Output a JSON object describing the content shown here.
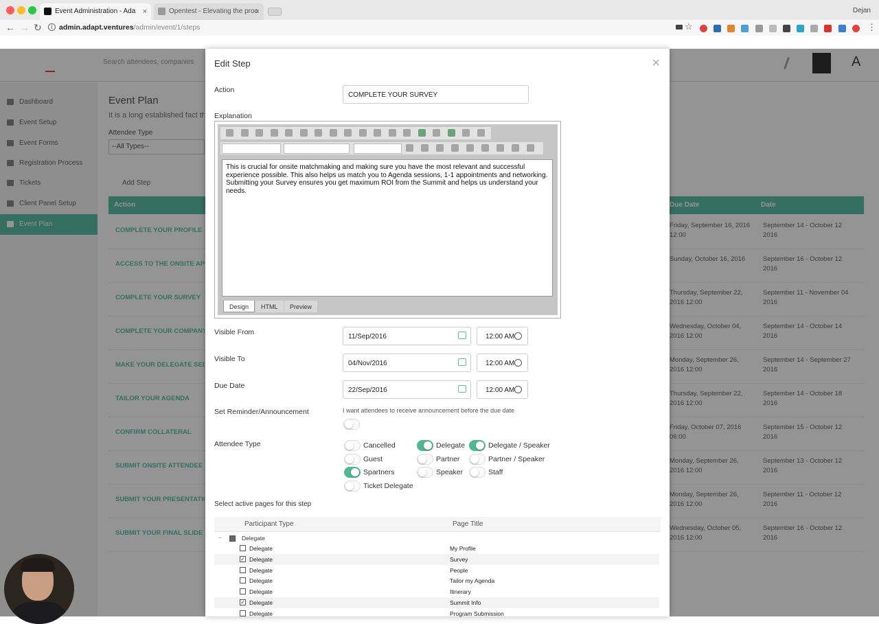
{
  "browser": {
    "tabs": [
      {
        "label": "Event Administration - Ada",
        "active": true
      },
      {
        "label": "Opentest - Elevating the proc",
        "active": false
      }
    ],
    "url_host": "admin.adapt.ventures",
    "url_path": "/admin/event/1/steps",
    "user": "Dejan"
  },
  "app": {
    "search_placeholder": "Search attendees, companies",
    "sidebar": [
      {
        "label": "Dashboard",
        "icon": "chart-icon"
      },
      {
        "label": "Event Setup",
        "icon": "pencil-icon"
      },
      {
        "label": "Event Forms",
        "icon": "grid-icon"
      },
      {
        "label": "Registration Process",
        "icon": "grid-icon"
      },
      {
        "label": "Tickets",
        "icon": "ticket-icon"
      },
      {
        "label": "Client Panel Setup",
        "icon": "grid-icon"
      },
      {
        "label": "Event Plan",
        "icon": "calendar-icon",
        "active": true
      }
    ],
    "page_title": "Event Plan",
    "page_desc": "It is a long established fact that",
    "attendee_type_label": "Attendee Type",
    "attendee_type_value": "--All Types--",
    "add_step": "Add Step",
    "table_headers": {
      "action": "Action",
      "due_date": "Due Date",
      "date": "Date"
    },
    "rows": [
      {
        "action": "COMPLETE YOUR PROFILE",
        "due": "Friday, September 16, 2016 12:00",
        "date": "September 14 - October 12 2016"
      },
      {
        "action": "ACCESS TO THE ONSITE APP",
        "due": "Sunday, October 16, 2016",
        "date": "September 16 - October 12 2016"
      },
      {
        "action": "COMPLETE YOUR SURVEY",
        "due": "Thursday, September 22, 2016 12:00",
        "date": "September 11 - November 04 2016"
      },
      {
        "action": "COMPLETE YOUR COMPANY",
        "due": "Wednesday, October 04, 2016 12:00",
        "date": "September 14 - October 14 2016"
      },
      {
        "action": "MAKE YOUR DELEGATE SELECTIONS",
        "due": "Monday, September 26, 2016 12:00",
        "date": "September 14 - September 27 2016"
      },
      {
        "action": "TAILOR YOUR AGENDA",
        "due": "Thursday, September 22, 2016 12:00",
        "date": "September 14 - October 18 2016"
      },
      {
        "action": "CONFIRM COLLATERAL",
        "due": "Friday, October 07, 2016 06:00",
        "date": "September 15 - October 12 2016"
      },
      {
        "action": "SUBMIT ONSITE ATTENDEE",
        "due": "Monday, September 26, 2016 12:00",
        "date": "September 13 - October 12 2016"
      },
      {
        "action": "SUBMIT YOUR PRESENTATION",
        "due": "Monday, September 26, 2016 12:00",
        "date": "September 11 - October 12 2016"
      },
      {
        "action": "SUBMIT YOUR FINAL SLIDE DECK",
        "due": "Wednesday, October 05, 2016 12:00",
        "date": "September 16 - October 12 2016"
      }
    ]
  },
  "modal": {
    "title": "Edit Step",
    "close_icon": "close-icon",
    "action_label": "Action",
    "action_value": "COMPLETE YOUR SURVEY",
    "explanation_label": "Explanation",
    "explanation_text": "This is crucial for onsite matchmaking and making sure you have the most relevant and successful experience possible. This also helps us match you to Agenda sessions, 1-1 appointments and networking.  Submitting your Survey ensures you get maximum ROI from the Summit and helps us understand your needs.",
    "editor_tabs": [
      "Design",
      "HTML",
      "Preview"
    ],
    "visible_from_label": "Visible From",
    "visible_from_date": "11/Sep/2016",
    "visible_from_time": "12:00 AM",
    "visible_to_label": "Visible To",
    "visible_to_date": "04/Nov/2016",
    "visible_to_time": "12:00 AM",
    "due_date_label": "Due Date",
    "due_date_date": "22/Sep/2016",
    "due_date_time": "12:00 AM",
    "reminder_label": "Set Reminder/Announcement",
    "reminder_text": "I want attendees to receive announcement before the due date",
    "reminder_on": false,
    "attendee_type_label": "Attendee Type",
    "attendee_types": [
      {
        "label": "Cancelled",
        "on": false
      },
      {
        "label": "Delegate",
        "on": true
      },
      {
        "label": "Delegate / Speaker",
        "on": true
      },
      {
        "label": "Guest",
        "on": false
      },
      {
        "label": "Partner",
        "on": false
      },
      {
        "label": "Partner / Speaker",
        "on": false
      },
      {
        "label": "Spartners",
        "on": true
      },
      {
        "label": "Speaker",
        "on": false
      },
      {
        "label": "Staff",
        "on": false
      },
      {
        "label": "Ticket Delegate",
        "on": false
      }
    ],
    "pages_label": "Select active pages for this step",
    "pages_headers": {
      "type": "Participant Type",
      "title": "Page Title"
    },
    "pages_group": "Delegate",
    "pages": [
      {
        "type": "Delegate",
        "title": "My Profile",
        "checked": false
      },
      {
        "type": "Delegate",
        "title": "Survey",
        "checked": true
      },
      {
        "type": "Delegate",
        "title": "People",
        "checked": false
      },
      {
        "type": "Delegate",
        "title": "Tailor my Agenda",
        "checked": false
      },
      {
        "type": "Delegate",
        "title": "Itinerary",
        "checked": false
      },
      {
        "type": "Delegate",
        "title": "Summit Info",
        "checked": true
      },
      {
        "type": "Delegate",
        "title": "Program Submission",
        "checked": false
      }
    ]
  },
  "colors": {
    "accent": "#5bbfa5",
    "toggle_on": "#4fb893"
  }
}
